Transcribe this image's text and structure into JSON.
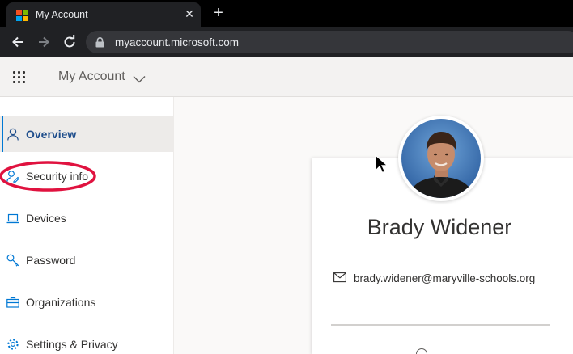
{
  "browser": {
    "tab_title": "My Account",
    "tab_close_glyph": "✕",
    "new_tab_glyph": "+",
    "url": "myaccount.microsoft.com",
    "logo_colors": [
      "#f25022",
      "#7fba00",
      "#00a4ef",
      "#ffb900"
    ]
  },
  "header": {
    "app_title": "My Account"
  },
  "sidebar": {
    "items": [
      {
        "label": "Overview",
        "icon": "person-icon",
        "active": true
      },
      {
        "label": "Security info",
        "icon": "person-key-icon",
        "active": false
      },
      {
        "label": "Devices",
        "icon": "laptop-icon",
        "active": false
      },
      {
        "label": "Password",
        "icon": "key-icon",
        "active": false
      },
      {
        "label": "Organizations",
        "icon": "briefcase-icon",
        "active": false
      },
      {
        "label": "Settings & Privacy",
        "icon": "gear-icon",
        "active": false
      }
    ]
  },
  "profile": {
    "name": "Brady Widener",
    "email": "brady.widener@maryville-schools.org"
  },
  "colors": {
    "accent": "#0078d4",
    "annotation": "#e0123f"
  }
}
